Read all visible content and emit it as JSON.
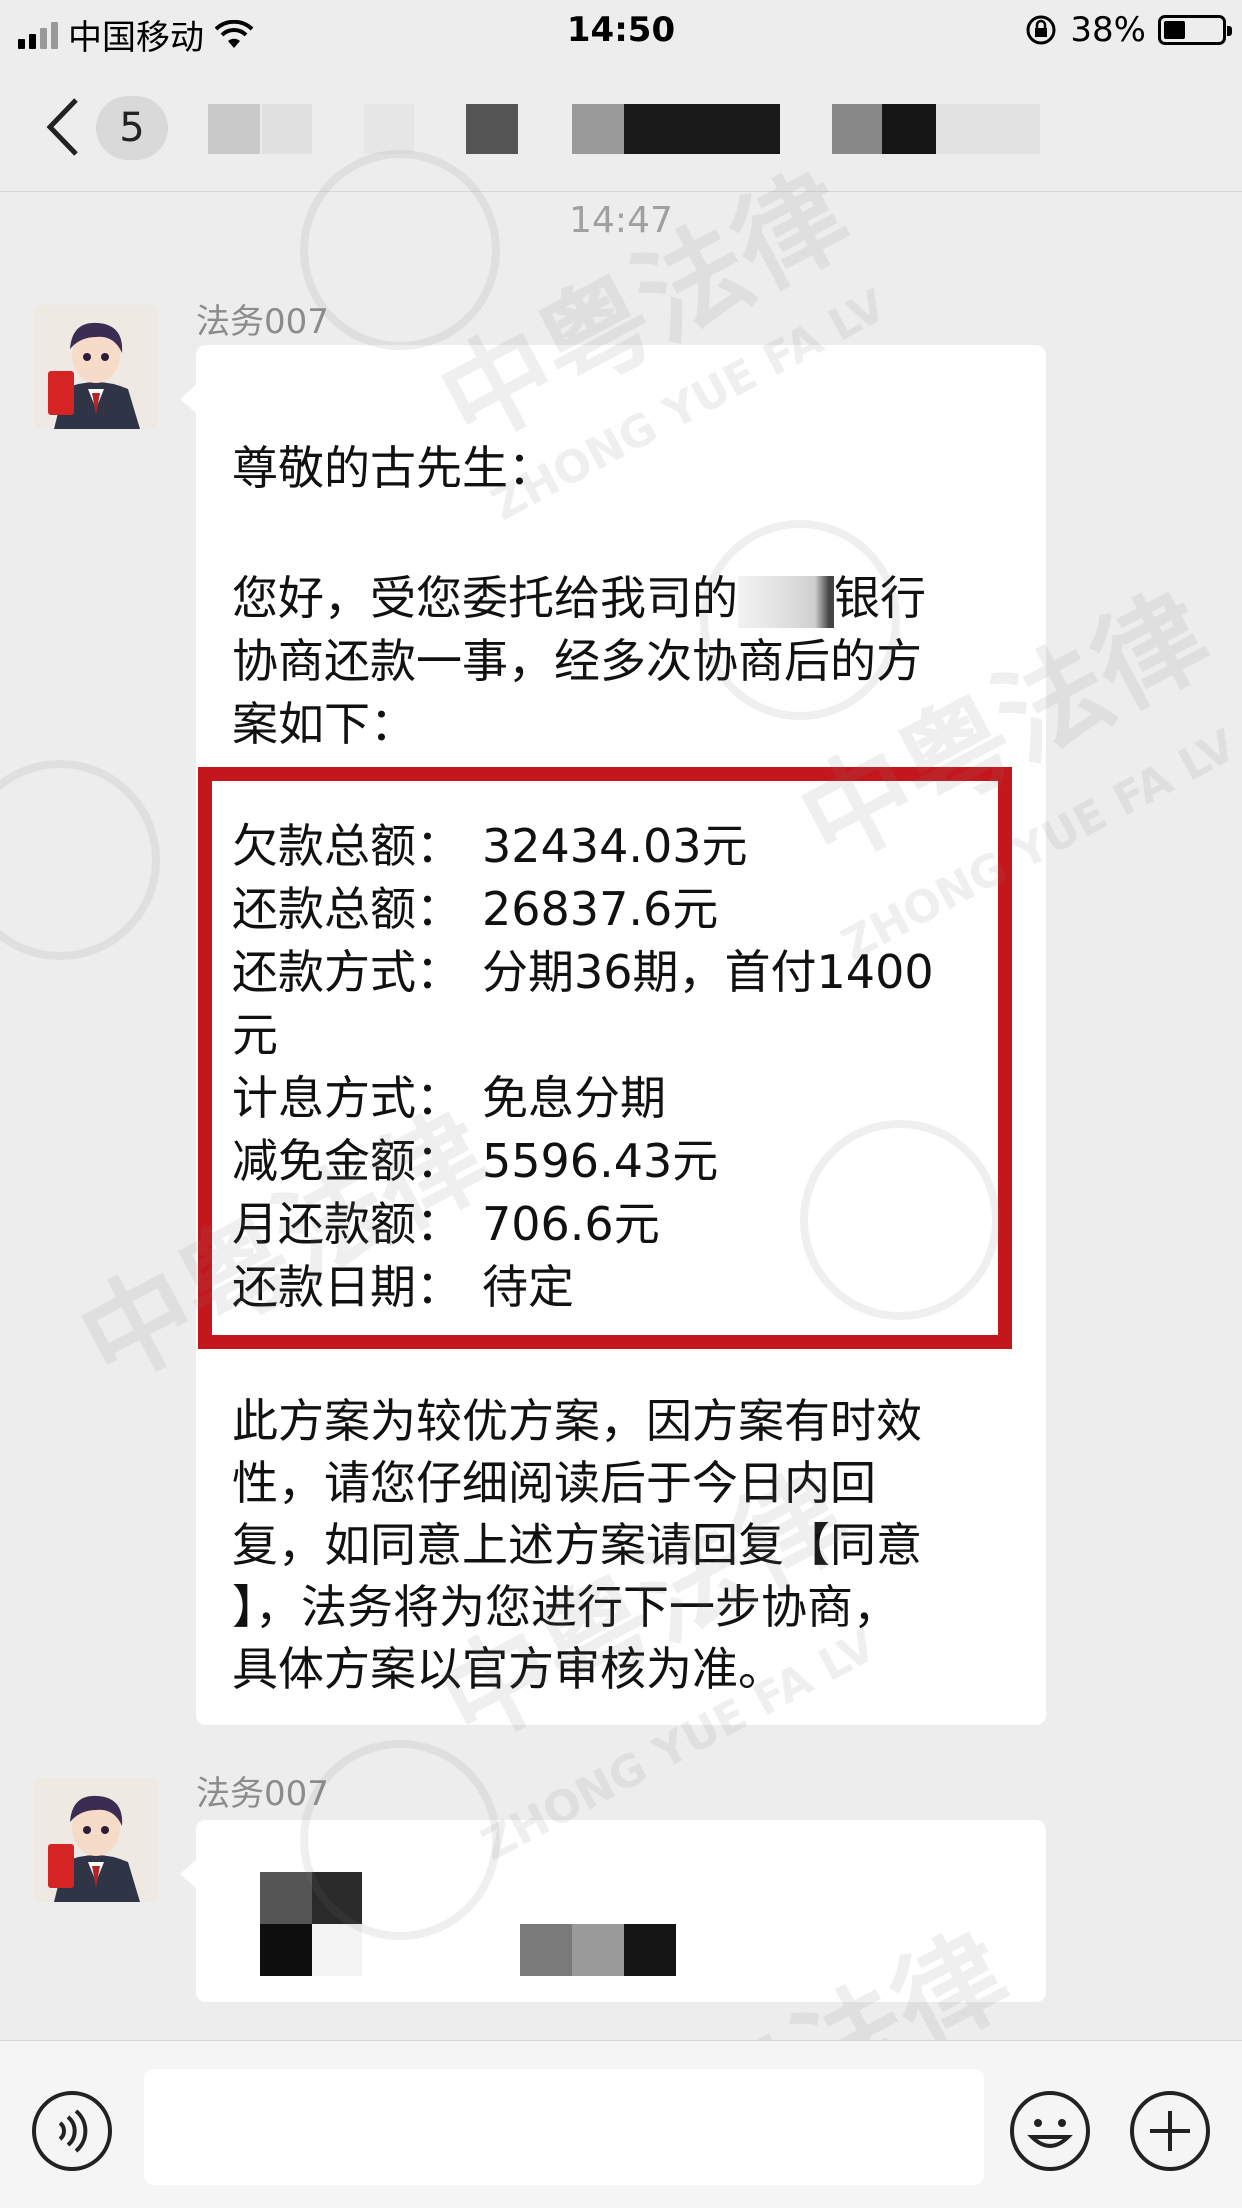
{
  "status_bar": {
    "carrier": "中国移动",
    "time": "14:50",
    "battery_percent": "38%",
    "battery_level": 0.38
  },
  "nav": {
    "unread_count": "5"
  },
  "timestamp": "14:47",
  "messages": [
    {
      "sender": "法务007",
      "greeting": "尊敬的古先生：",
      "intro_part1": "您好，受您委托给我司的",
      "intro_part2": "银行",
      "intro_line2": "协商还款一事，经多次协商后的方",
      "intro_line3": "案如下：",
      "details": [
        {
          "label": "欠款总额：",
          "value": "32434.03元"
        },
        {
          "label": "还款总额：",
          "value": "26837.6元"
        },
        {
          "label": "还款方式：",
          "value": "分期36期，首付1400"
        },
        {
          "label": "",
          "value": "元"
        },
        {
          "label": "计息方式：",
          "value": "免息分期"
        },
        {
          "label": "减免金额：",
          "value": "5596.43元"
        },
        {
          "label": "月还款额：",
          "value": "706.6元"
        },
        {
          "label": "还款日期：",
          "value": "待定"
        }
      ],
      "closing": [
        "此方案为较优方案，因方案有时效",
        "性，请您仔细阅读后于今日内回",
        "复，如同意上述方案请回复【同意",
        "】，法务将为您进行下一步协商，",
        "具体方案以官方审核为准。"
      ]
    },
    {
      "sender": "法务007"
    }
  ],
  "watermark": {
    "brand": "中粤法律",
    "brand_latin": "ZHONG YUE FA LV",
    "seal_char": "中"
  },
  "colors": {
    "highlight_border": "#c4171d",
    "background": "#ededed",
    "bubble": "#ffffff"
  },
  "icons": [
    "back-icon",
    "wifi-icon",
    "rotation-lock-icon",
    "battery-icon",
    "voice-icon",
    "emoji-icon",
    "plus-icon"
  ]
}
